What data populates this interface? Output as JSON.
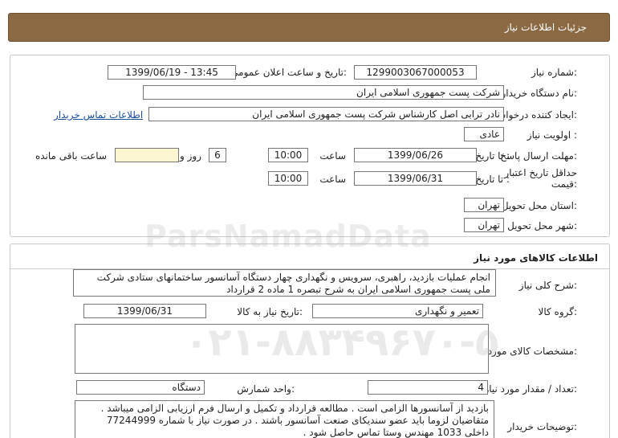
{
  "header": {
    "title": "جزئیات اطلاعات نیاز"
  },
  "need_info": {
    "need_number_label": "شماره نیاز:",
    "need_number": "1299003067000053",
    "announce_label": "تاریخ و ساعت اعلان عمومی:",
    "announce_value": "1399/06/19 - 13:45",
    "buyer_org_label": "نام دستگاه خریدار:",
    "buyer_org": "شرکت پست جمهوری اسلامی ایران",
    "creator_label": "ایجاد کننده درخواست:",
    "creator": "نادر ترابی اصل کارشناس شرکت پست جمهوری اسلامی ایران",
    "contact_link": "اطلاعات تماس خریدار",
    "priority_label": "اولویت نیاز :",
    "priority": "عادی",
    "reply_deadline_label": "مهلت ارسال پاسخ:",
    "until_date_label": "تا تاریخ :",
    "reply_date": "1399/06/26",
    "time_label": "ساعت",
    "reply_time": "10:00",
    "days_value": "6",
    "days_label": "روز و",
    "remaining_value": "",
    "remaining_label": "ساعت باقی مانده",
    "min_validity_label_1": "حداقل تاریخ اعتبار",
    "min_validity_label_2": "قیمت:",
    "validity_until_label": "تا تاریخ :",
    "validity_date": "1399/06/31",
    "validity_time_label": "ساعت",
    "validity_time": "10:00",
    "delivery_province_label": "استان محل تحویل:",
    "delivery_province": "تهران",
    "delivery_city_label": "شهر محل تحویل:",
    "delivery_city": "تهران"
  },
  "goods": {
    "section_title": "اطلاعات کالاهای مورد نیاز",
    "general_desc_label": "شرح کلی نیاز:",
    "general_desc": "انجام عملیات بازدید، راهبری، سرویس و نگهداری  چهار  دستگاه آسانسور ساختمانهای ستادی شرکت ملی پست جمهوری اسلامی ایران به شرح تبصره 1 ماده 2 قرارداد",
    "goods_group_label": "گروه کالا:",
    "goods_group": "تعمیر و نگهداری",
    "need_date_label": "تاریخ نیاز به کالا:",
    "need_date": "1399/06/31",
    "goods_spec_label": "مشخصات کالای مورد نیاز:",
    "goods_spec": "",
    "quantity_label": "تعداد / مقدار مورد نیاز:",
    "quantity": "4",
    "unit_label": "واحد شمارش:",
    "unit": "دستگاه",
    "buyer_notes_label": "توضیحات خریدار:",
    "buyer_notes": "بازدید از آسانسورها الزامی است . مطالعه قرارداد و تکمیل و ارسال فرم ارزیابی الزامی میباشد . متقاضیان لزوما باید عضو سندیکای صنعت آسانسور باشند . در صورت نیاز با شماره 77244999 داخلی 1033 مهندس وستا تماس حاصل شود ."
  },
  "watermark": {
    "brand": "ParsNamadData",
    "phone": "۰۲۱-۸۸۳۴۹۶۷۰-۵"
  }
}
